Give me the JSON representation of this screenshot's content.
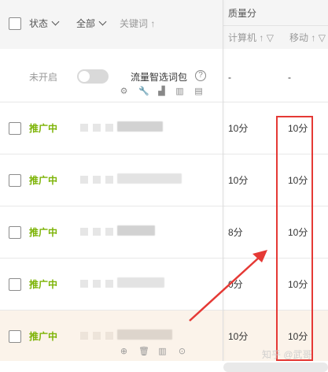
{
  "header": {
    "status_label": "状态",
    "filter_all_label": "全部",
    "keyword_label": "关键词",
    "keyword_sort_icon": "↑",
    "quality_label": "质量分",
    "computer_label": "计算机",
    "computer_sort_icon": "↑",
    "computer_filter_icon": "▽",
    "mobile_label": "移动",
    "mobile_sort_icon": "↑",
    "mobile_filter_icon": "▽"
  },
  "smart_row": {
    "status": "未开启",
    "title": "流量智选词包",
    "help_icon": "?",
    "computer": "-",
    "mobile": "-",
    "tool_icons": [
      "gear-icon",
      "wrench-icon",
      "bar-chart-icon",
      "column-chart-icon",
      "clipboard-icon"
    ]
  },
  "rows": [
    {
      "status": "推广中",
      "computer": "10分",
      "mobile": "10分"
    },
    {
      "status": "推广中",
      "computer": "10分",
      "mobile": "10分"
    },
    {
      "status": "推广中",
      "computer": "8分",
      "mobile": "10分"
    },
    {
      "status": "推广中",
      "computer": "0分",
      "mobile": "10分"
    },
    {
      "status": "推广中",
      "computer": "10分",
      "mobile": "10分"
    }
  ],
  "row_actions": [
    "target-icon",
    "trash-icon",
    "column-chart-icon",
    "more-icon"
  ],
  "annotation": {
    "color": "#e53935"
  },
  "watermark": "知乎 @武哥",
  "colors": {
    "active_status": "#7cb305",
    "header_bg": "#f5f5f5",
    "highlight_row_bg": "#fbf3ea"
  }
}
